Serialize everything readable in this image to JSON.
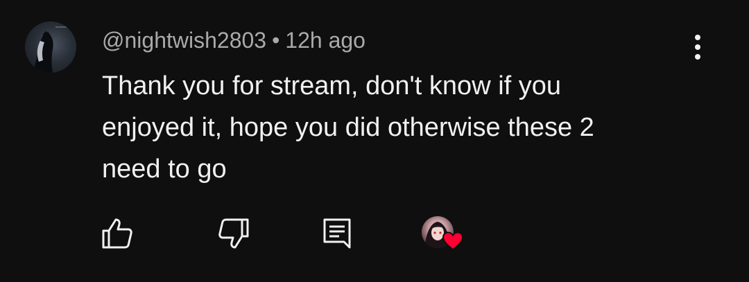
{
  "comment": {
    "username": "@nightwish2803",
    "separator": "•",
    "time": "12h ago",
    "lines": [
      "Thank you for stream, don't know if you",
      "enjoyed it, hope you did otherwise these 2",
      "need to go"
    ]
  },
  "colors": {
    "background": "#0f0f0f",
    "text": "#f1f1f1",
    "meta": "#aaaaaa",
    "heart": "#ff0033"
  },
  "icons": {
    "menu": "more-vertical-icon",
    "like": "thumbs-up-icon",
    "dislike": "thumbs-down-icon",
    "reply": "reply-comment-icon",
    "creator_heart": "heart-icon"
  }
}
